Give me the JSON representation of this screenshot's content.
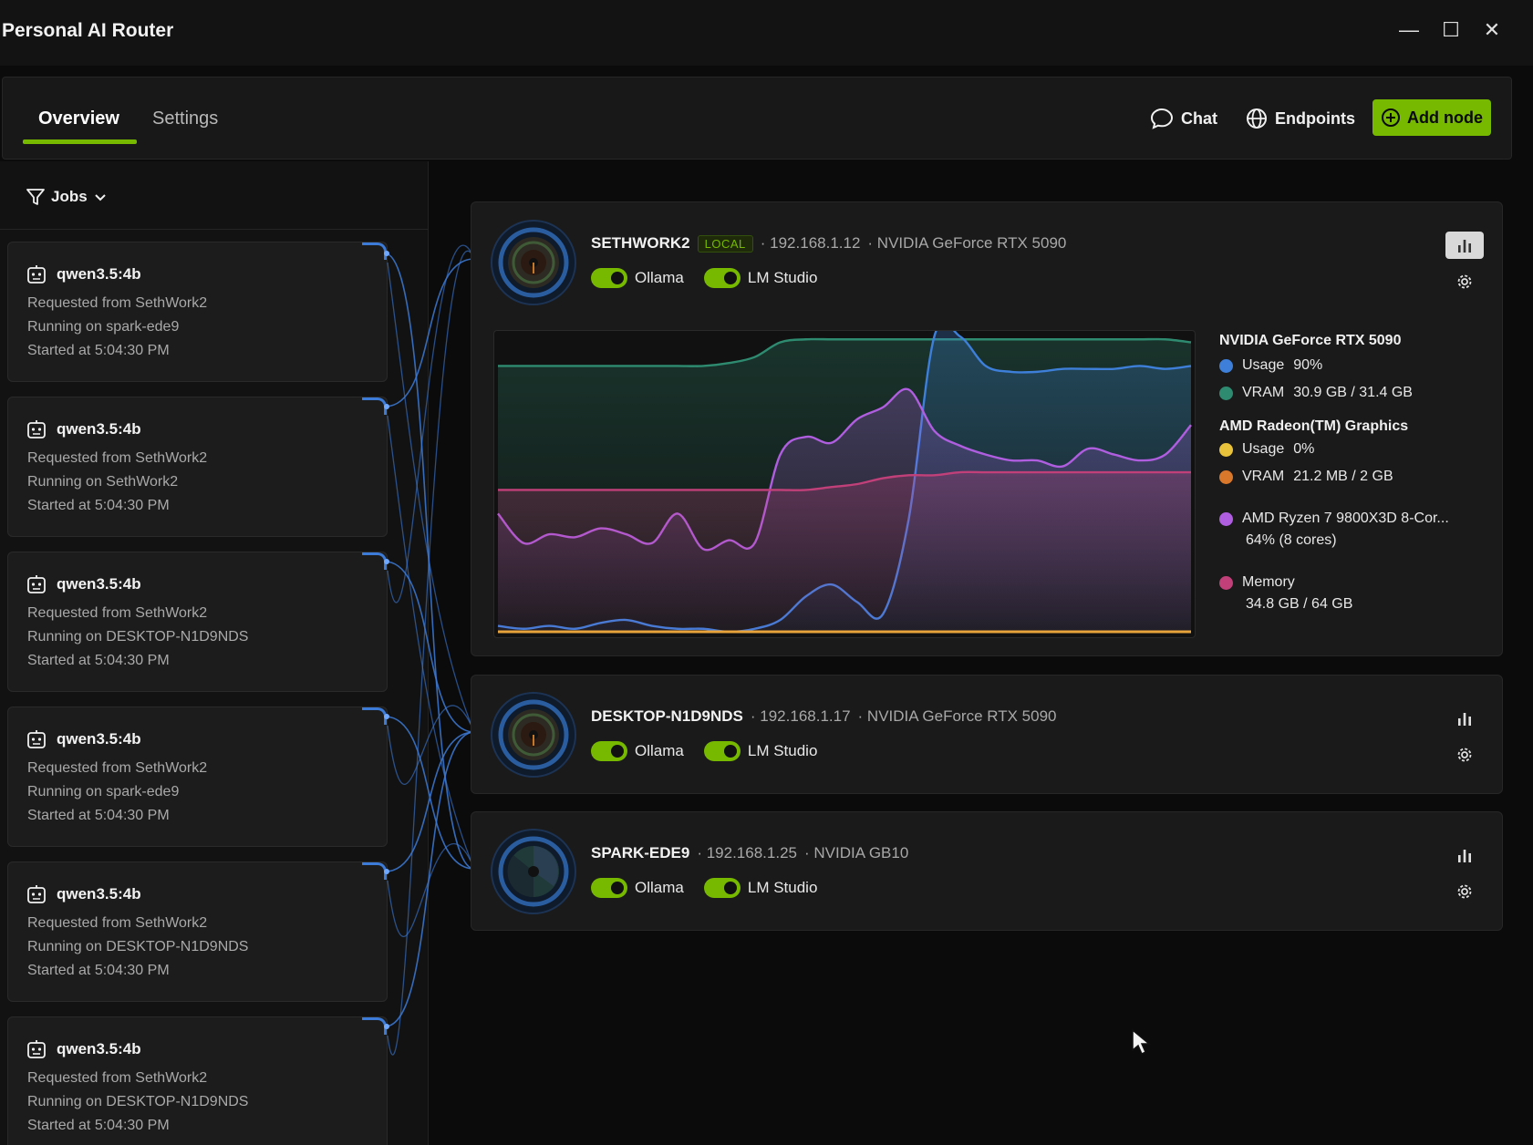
{
  "window": {
    "title": "Personal AI Router",
    "minimize": "—",
    "maximize": "☐",
    "close": "✕"
  },
  "nav": {
    "tabs": [
      {
        "label": "Overview",
        "active": true
      },
      {
        "label": "Settings",
        "active": false
      }
    ],
    "chat_label": "Chat",
    "endpoints_label": "Endpoints",
    "add_node_label": "Add node",
    "accent_color": "#76b900"
  },
  "jobs": {
    "filter_label": "Jobs",
    "items": [
      {
        "model": "qwen3.5:4b",
        "requested": "Requested from SethWork2",
        "running": "Running on spark-ede9",
        "started": "Started at 5:04:30 PM"
      },
      {
        "model": "qwen3.5:4b",
        "requested": "Requested from SethWork2",
        "running": "Running on SethWork2",
        "started": "Started at 5:04:30 PM"
      },
      {
        "model": "qwen3.5:4b",
        "requested": "Requested from SethWork2",
        "running": "Running on DESKTOP-N1D9NDS",
        "started": "Started at 5:04:30 PM"
      },
      {
        "model": "qwen3.5:4b",
        "requested": "Requested from SethWork2",
        "running": "Running on spark-ede9",
        "started": "Started at 5:04:30 PM"
      },
      {
        "model": "qwen3.5:4b",
        "requested": "Requested from SethWork2",
        "running": "Running on DESKTOP-N1D9NDS",
        "started": "Started at 5:04:30 PM"
      },
      {
        "model": "qwen3.5:4b",
        "requested": "Requested from SethWork2",
        "running": "Running on DESKTOP-N1D9NDS",
        "started": "Started at 5:04:30 PM"
      }
    ]
  },
  "nodes": [
    {
      "name": "SETHWORK2",
      "badge": "LOCAL",
      "ip": "· 192.168.1.12",
      "gpu": "· NVIDIA GeForce RTX 5090",
      "toggle1": "Ollama",
      "toggle2": "LM Studio"
    },
    {
      "name": "DESKTOP-N1D9NDS",
      "ip": "· 192.168.1.17",
      "gpu": "· NVIDIA GeForce RTX 5090",
      "toggle1": "Ollama",
      "toggle2": "LM Studio"
    },
    {
      "name": "SPARK-EDE9",
      "ip": "· 192.168.1.25",
      "gpu": "· NVIDIA GB10",
      "toggle1": "Ollama",
      "toggle2": "LM Studio"
    }
  ],
  "legend": {
    "gpu1_title": "NVIDIA GeForce RTX 5090",
    "gpu1_usage_label": "Usage",
    "gpu1_usage_value": "90%",
    "gpu1_vram_label": "VRAM",
    "gpu1_vram_value": "30.9 GB / 31.4 GB",
    "gpu2_title": "AMD Radeon(TM) Graphics",
    "gpu2_usage_label": "Usage",
    "gpu2_usage_value": "0%",
    "gpu2_vram_label": "VRAM",
    "gpu2_vram_value": "21.2 MB / 2 GB",
    "cpu_label": "AMD Ryzen 7 9800X3D 8-Cor...",
    "cpu_value": "64% (8 cores)",
    "mem_label": "Memory",
    "mem_value": "34.8 GB / 64 GB"
  },
  "chart_data": {
    "type": "area",
    "ylim": [
      0,
      100
    ],
    "series": [
      {
        "name": "VRAM",
        "color": "#2e8b70",
        "values": [
          90,
          90,
          90,
          90,
          90,
          90,
          90,
          90,
          90,
          91,
          93,
          98,
          99,
          99,
          99,
          99,
          99,
          99,
          99,
          99,
          99,
          99,
          99,
          99,
          99,
          99,
          99,
          98
        ]
      },
      {
        "name": "Usage",
        "color": "#3d7fd9",
        "values": [
          2,
          1,
          2,
          1,
          3,
          4,
          2,
          1,
          1,
          0,
          1,
          4,
          12,
          16,
          10,
          6,
          38,
          100,
          100,
          90,
          88,
          88,
          89,
          89,
          89,
          90,
          89,
          90
        ]
      },
      {
        "name": "AMD Ryzen 7 9800X3D 8-Cor...",
        "color": "#b05ee0",
        "values": [
          40,
          30,
          33,
          32,
          35,
          33,
          30,
          40,
          28,
          31,
          30,
          60,
          66,
          64,
          72,
          76,
          82,
          68,
          63,
          60,
          58,
          58,
          56,
          62,
          60,
          58,
          60,
          70
        ]
      },
      {
        "name": "Memory",
        "color": "#c2407a",
        "values": [
          48,
          48,
          48,
          48,
          48,
          48,
          48,
          48,
          48,
          48,
          48,
          48,
          48,
          49,
          50,
          52,
          53,
          53,
          54,
          54,
          54,
          54,
          54,
          54,
          54,
          54,
          54,
          54
        ]
      },
      {
        "name": "Usage",
        "color": "#e8a33a",
        "values": [
          0,
          0,
          0,
          0,
          0,
          0,
          0,
          0,
          0,
          0,
          0,
          0,
          0,
          0,
          0,
          0,
          0,
          0,
          0,
          0,
          0,
          0,
          0,
          0,
          0,
          0,
          0,
          0
        ]
      }
    ]
  },
  "colors": {
    "gpu1_usage": "#3d7fd9",
    "gpu1_vram": "#2e8b70",
    "gpu2_usage": "#e8c23a",
    "gpu2_vram": "#d9772a",
    "cpu": "#b05ee0",
    "memory": "#c2407a"
  }
}
